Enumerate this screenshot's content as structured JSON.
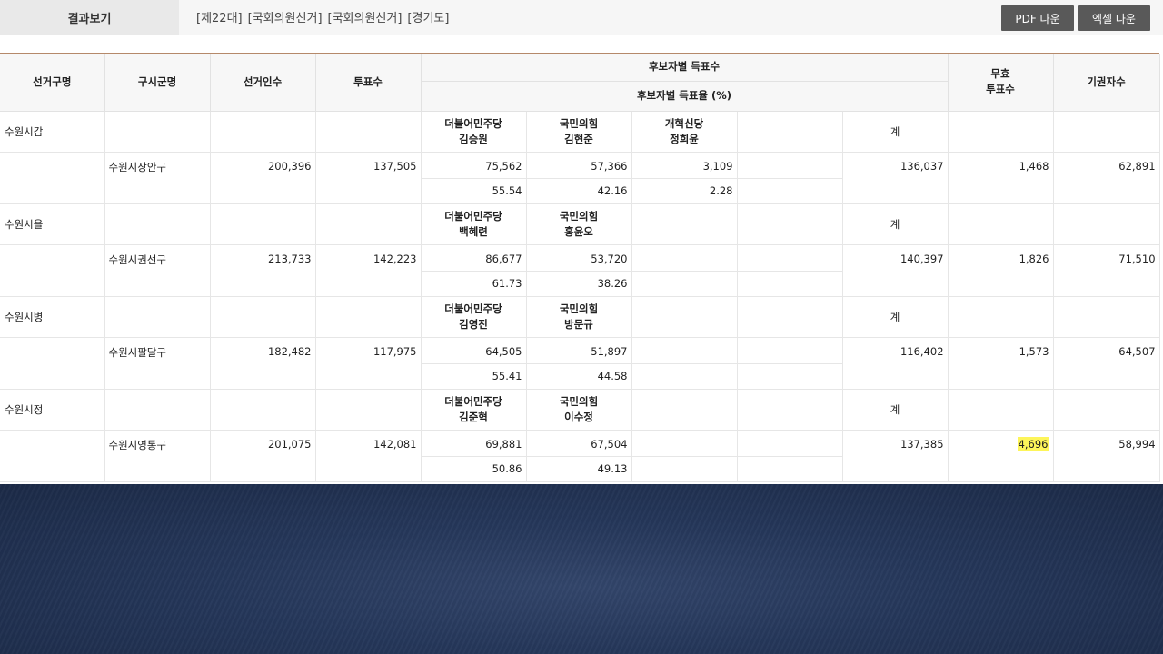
{
  "topbar": {
    "tab_label": "결과보기",
    "breadcrumb": [
      "[제22대]",
      "[국회의원선거]",
      "[국회의원선거]",
      "[경기도]"
    ],
    "pdf_button": "PDF 다운",
    "excel_button": "엑셀 다운"
  },
  "table": {
    "headers": {
      "district": "선거구명",
      "city": "구시군명",
      "electors": "선거인수",
      "votes": "투표수",
      "candidate_votes": "후보자별 득표수",
      "candidate_pct": "후보자별 득표율 (%)",
      "invalid_line1": "무효",
      "invalid_line2": "투표수",
      "abstain": "기권자수"
    },
    "total_label": "계",
    "districts": [
      {
        "name": "수원시갑",
        "city": "수원시장안구",
        "electors": "200,396",
        "votes": "137,505",
        "candidates": [
          {
            "party": "더불어민주당",
            "name": "김승원",
            "votes": "75,562",
            "pct": "55.54"
          },
          {
            "party": "국민의힘",
            "name": "김현준",
            "votes": "57,366",
            "pct": "42.16"
          },
          {
            "party": "개혁신당",
            "name": "정희윤",
            "votes": "3,109",
            "pct": "2.28"
          }
        ],
        "total": "136,037",
        "invalid": "1,468",
        "abstain": "62,891"
      },
      {
        "name": "수원시을",
        "city": "수원시권선구",
        "electors": "213,733",
        "votes": "142,223",
        "candidates": [
          {
            "party": "더불어민주당",
            "name": "백혜련",
            "votes": "86,677",
            "pct": "61.73"
          },
          {
            "party": "국민의힘",
            "name": "홍윤오",
            "votes": "53,720",
            "pct": "38.26"
          },
          {
            "party": "",
            "name": "",
            "votes": "",
            "pct": ""
          }
        ],
        "total": "140,397",
        "invalid": "1,826",
        "abstain": "71,510"
      },
      {
        "name": "수원시병",
        "city": "수원시팔달구",
        "electors": "182,482",
        "votes": "117,975",
        "candidates": [
          {
            "party": "더불어민주당",
            "name": "김영진",
            "votes": "64,505",
            "pct": "55.41"
          },
          {
            "party": "국민의힘",
            "name": "방문규",
            "votes": "51,897",
            "pct": "44.58"
          },
          {
            "party": "",
            "name": "",
            "votes": "",
            "pct": ""
          }
        ],
        "total": "116,402",
        "invalid": "1,573",
        "abstain": "64,507"
      },
      {
        "name": "수원시정",
        "city": "수원시영통구",
        "electors": "201,075",
        "votes": "142,081",
        "candidates": [
          {
            "party": "더불어민주당",
            "name": "김준혁",
            "votes": "69,881",
            "pct": "50.86"
          },
          {
            "party": "국민의힘",
            "name": "이수정",
            "votes": "67,504",
            "pct": "49.13"
          },
          {
            "party": "",
            "name": "",
            "votes": "",
            "pct": ""
          }
        ],
        "total": "137,385",
        "invalid": "4,696",
        "abstain": "58,994",
        "invalid_highlighted": true
      }
    ]
  },
  "colors": {
    "header_border": "#b5896a",
    "button_bg": "#595959",
    "highlight": "#fdf55a",
    "backdrop": "#25375a"
  }
}
